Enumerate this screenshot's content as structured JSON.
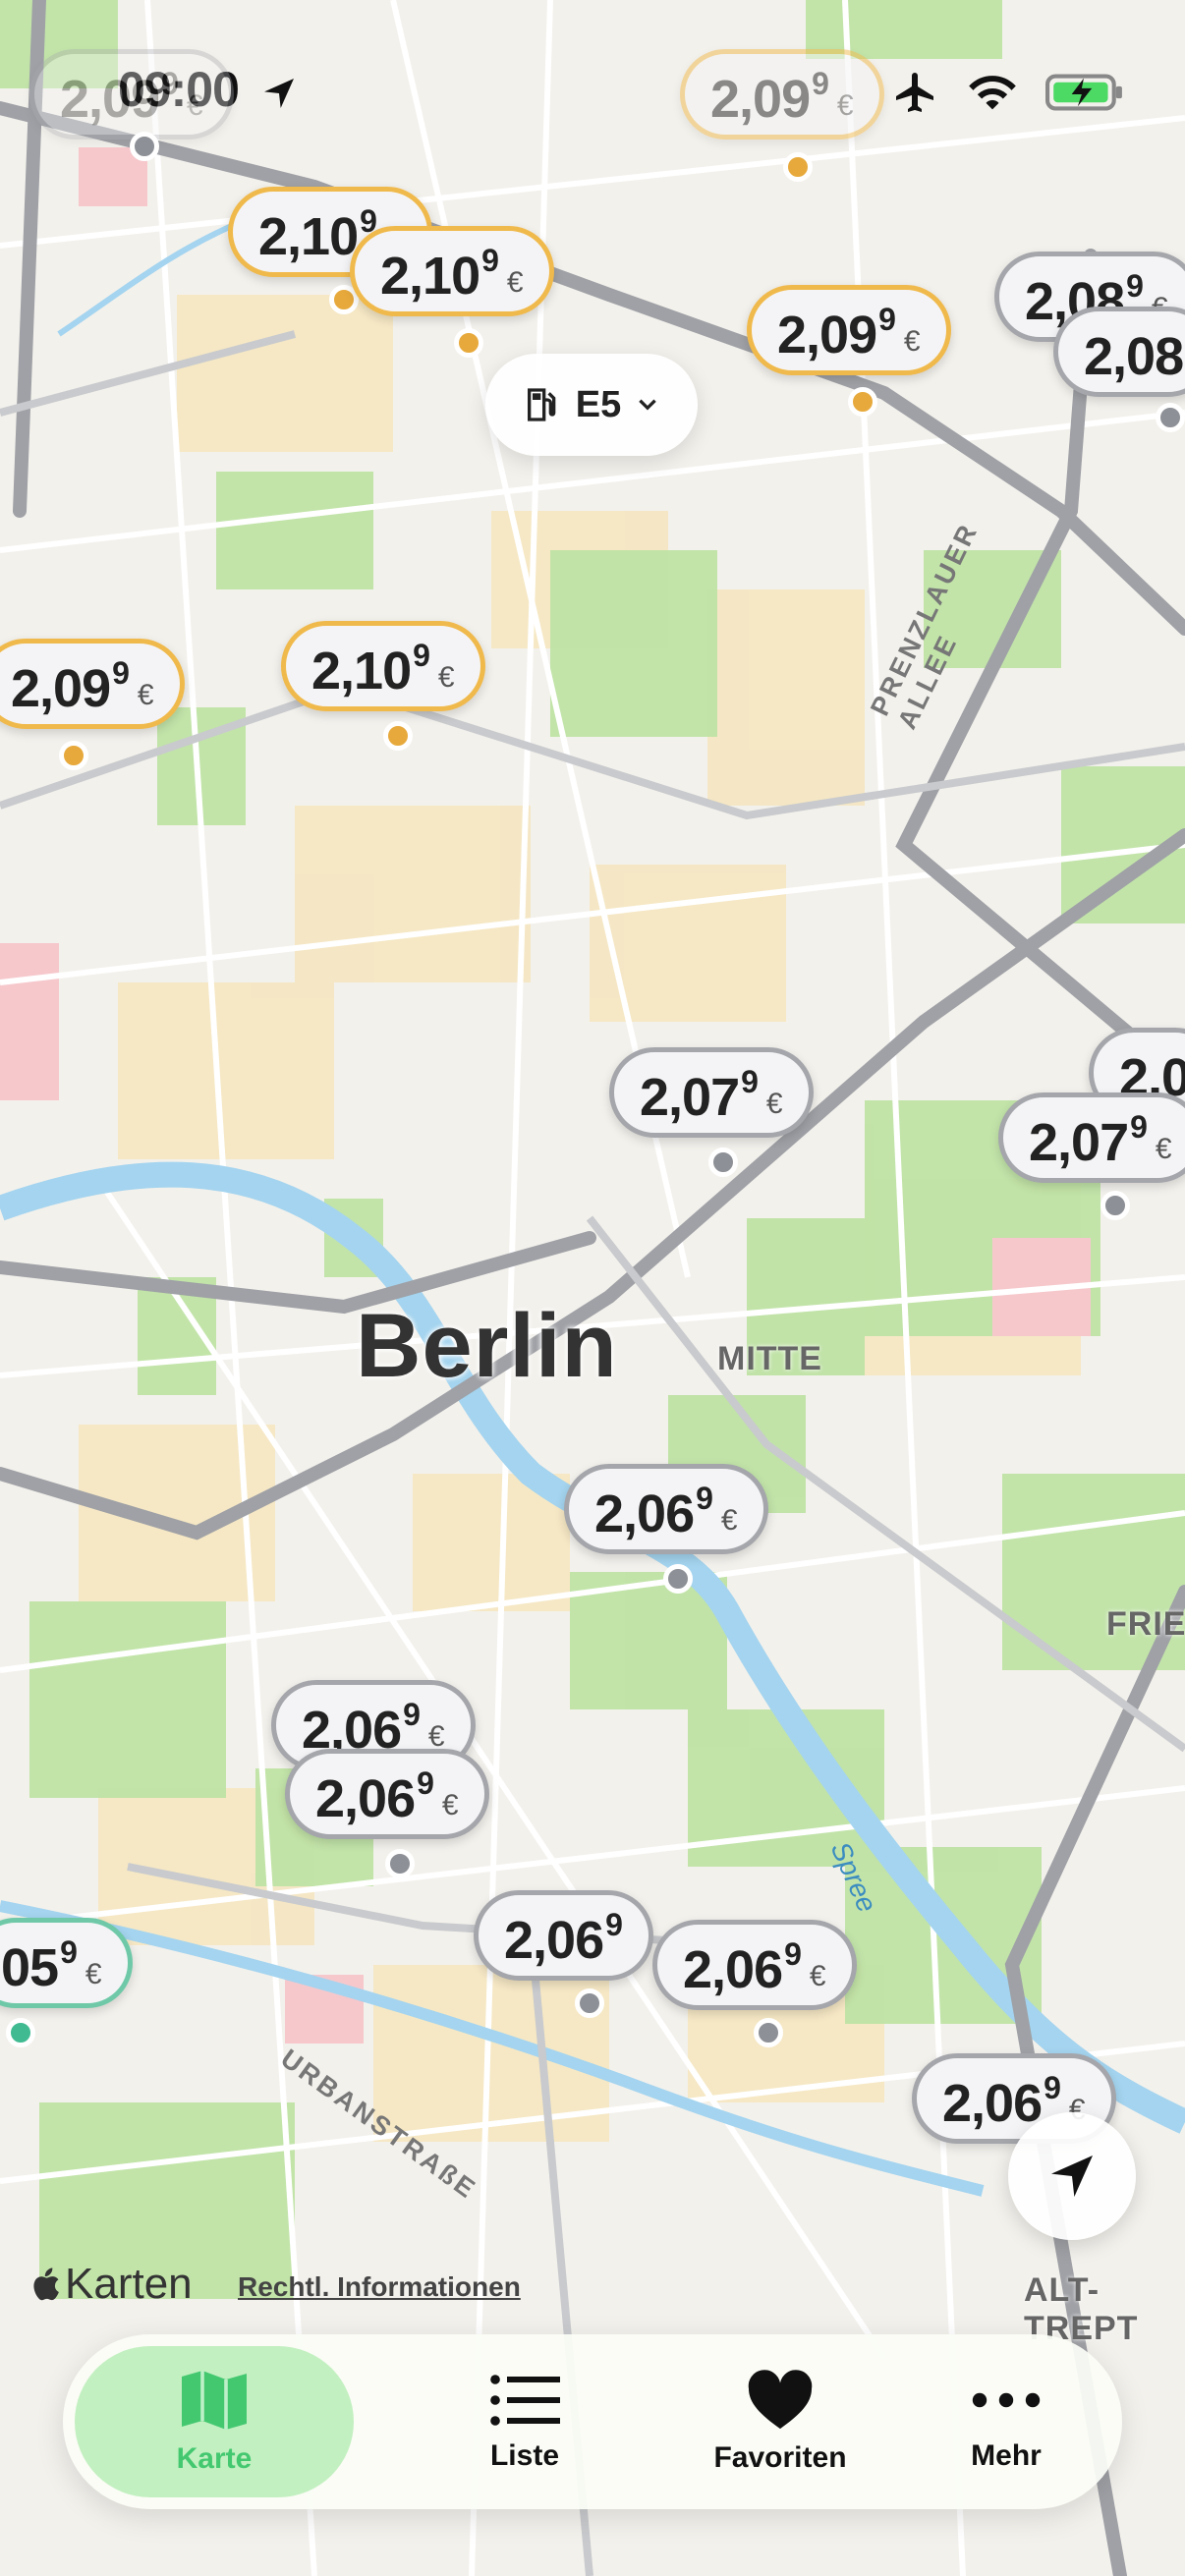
{
  "status_bar": {
    "time": "09:00"
  },
  "fuel_selector": {
    "label": "E5"
  },
  "map": {
    "city": "Berlin",
    "districts": [
      "MITTE",
      "FRIED",
      "ALT-TREPT"
    ],
    "streets": [
      "PRENZLAUER ALLEE",
      "URBANSTRAßE"
    ],
    "water": [
      "Spree"
    ]
  },
  "prices": [
    {
      "main": "2,09",
      "sup": "9",
      "cur": "€",
      "status": "orange"
    },
    {
      "main": "2,09",
      "sup": "9",
      "cur": "€",
      "status": "orange"
    },
    {
      "main": "2,10",
      "sup": "9",
      "cur": "€",
      "status": "orange"
    },
    {
      "main": "2,09",
      "sup": "9",
      "cur": "€",
      "status": "orange"
    },
    {
      "main": "2,08",
      "sup": "9",
      "cur": "€",
      "status": "gray"
    },
    {
      "main": "2,08",
      "sup": "",
      "cur": "",
      "status": "gray"
    },
    {
      "main": "2,09",
      "sup": "9",
      "cur": "€",
      "status": "orange"
    },
    {
      "main": "2,10",
      "sup": "9",
      "cur": "€",
      "status": "orange"
    },
    {
      "main": "2,07",
      "sup": "9",
      "cur": "€",
      "status": "gray"
    },
    {
      "main": "2,07",
      "sup": "9",
      "cur": "€",
      "status": "gray"
    },
    {
      "main": "2,06",
      "sup": "9",
      "cur": "€",
      "status": "gray"
    },
    {
      "main": "2,06",
      "sup": "9",
      "cur": "€",
      "status": "gray"
    },
    {
      "main": "2,06",
      "sup": "9",
      "cur": "€",
      "status": "gray"
    },
    {
      "main": "05",
      "sup": "9",
      "cur": "€",
      "status": "green"
    },
    {
      "main": "2,06",
      "sup": "9",
      "cur": "",
      "status": "gray"
    },
    {
      "main": "2,06",
      "sup": "9",
      "cur": "€",
      "status": "gray"
    },
    {
      "main": "2,06",
      "sup": "9",
      "cur": "€",
      "status": "gray"
    },
    {
      "main": "2,0",
      "sup": "",
      "cur": "",
      "status": "gray"
    }
  ],
  "attribution": {
    "brand": "Karten",
    "legal": "Rechtl. Informationen"
  },
  "tabs": [
    {
      "label": "Karte",
      "icon": "map-icon",
      "active": true
    },
    {
      "label": "Liste",
      "icon": "list-icon",
      "active": false
    },
    {
      "label": "Favoriten",
      "icon": "heart-icon",
      "active": false
    },
    {
      "label": "Mehr",
      "icon": "more-icon",
      "active": false
    }
  ],
  "colors": {
    "orange": "#f0b94b",
    "gray": "#a4a6ab",
    "green": "#6fc9a8",
    "accent": "#43c870"
  }
}
